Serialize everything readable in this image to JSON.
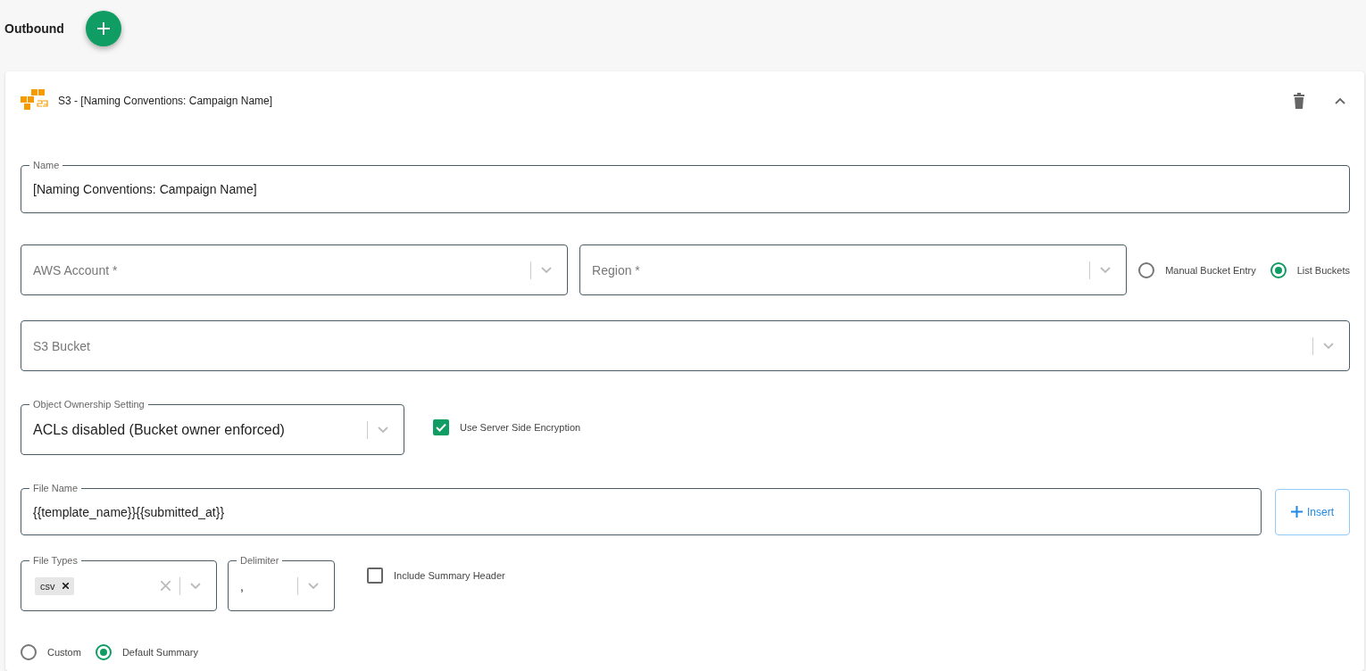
{
  "header": {
    "title": "Outbound"
  },
  "destination": {
    "title": "S3 - [Naming Conventions: Campaign Name]",
    "expanded": true
  },
  "name_field": {
    "label": "Name",
    "value": "[Naming Conventions: Campaign Name]"
  },
  "aws_account": {
    "placeholder": "AWS Account *"
  },
  "region": {
    "placeholder": "Region *"
  },
  "bucket_mode": [
    {
      "label": "Manual Bucket Entry",
      "selected": false
    },
    {
      "label": "List Buckets",
      "selected": true
    }
  ],
  "s3_bucket": {
    "placeholder": "S3 Bucket"
  },
  "object_ownership": {
    "label": "Object Ownership Setting",
    "value": "ACLs disabled (Bucket owner enforced)"
  },
  "server_side_encryption": {
    "label": "Use Server Side Encryption",
    "checked": true
  },
  "file_name": {
    "label": "File Name",
    "value": "{{template_name}}{{submitted_at}}"
  },
  "insert_button": {
    "label": "Insert"
  },
  "file_types": {
    "label": "File Types",
    "tags": [
      "csv"
    ]
  },
  "delimiter": {
    "label": "Delimiter",
    "value": ","
  },
  "include_summary_header": {
    "label": "Include Summary Header",
    "checked": false
  },
  "summary_mode": [
    {
      "label": "Custom",
      "selected": false
    },
    {
      "label": "Default Summary",
      "selected": true
    }
  ]
}
